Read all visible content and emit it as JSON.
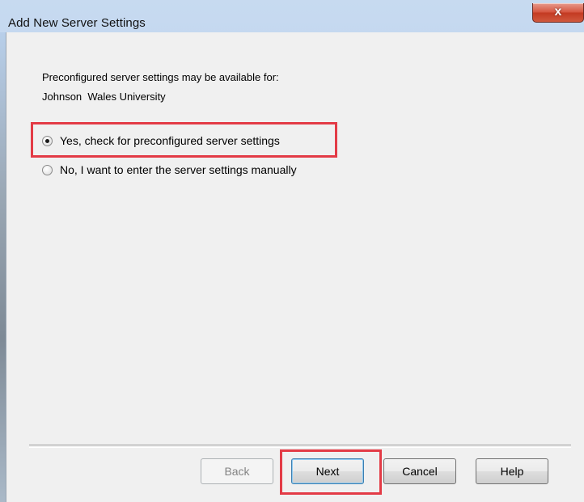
{
  "window": {
    "title": "Add New Server Settings",
    "close_glyph": "x"
  },
  "content": {
    "intro_text": "Preconfigured server settings may be available for:",
    "institution": "Johnson  Wales University"
  },
  "options": [
    {
      "label": "Yes, check for preconfigured server settings",
      "checked": true,
      "highlighted": true
    },
    {
      "label": "No, I want to enter the server settings manually",
      "checked": false,
      "highlighted": false
    }
  ],
  "buttons": {
    "back": {
      "label": "Back",
      "enabled": false
    },
    "next": {
      "label": "Next",
      "enabled": true,
      "default": true,
      "highlighted": true
    },
    "cancel": {
      "label": "Cancel",
      "enabled": true
    },
    "help": {
      "label": "Help",
      "enabled": true
    }
  },
  "colors": {
    "highlight": "#e33b46",
    "close_button": "#c7412b",
    "dialog_background": "#f0f0f0"
  }
}
